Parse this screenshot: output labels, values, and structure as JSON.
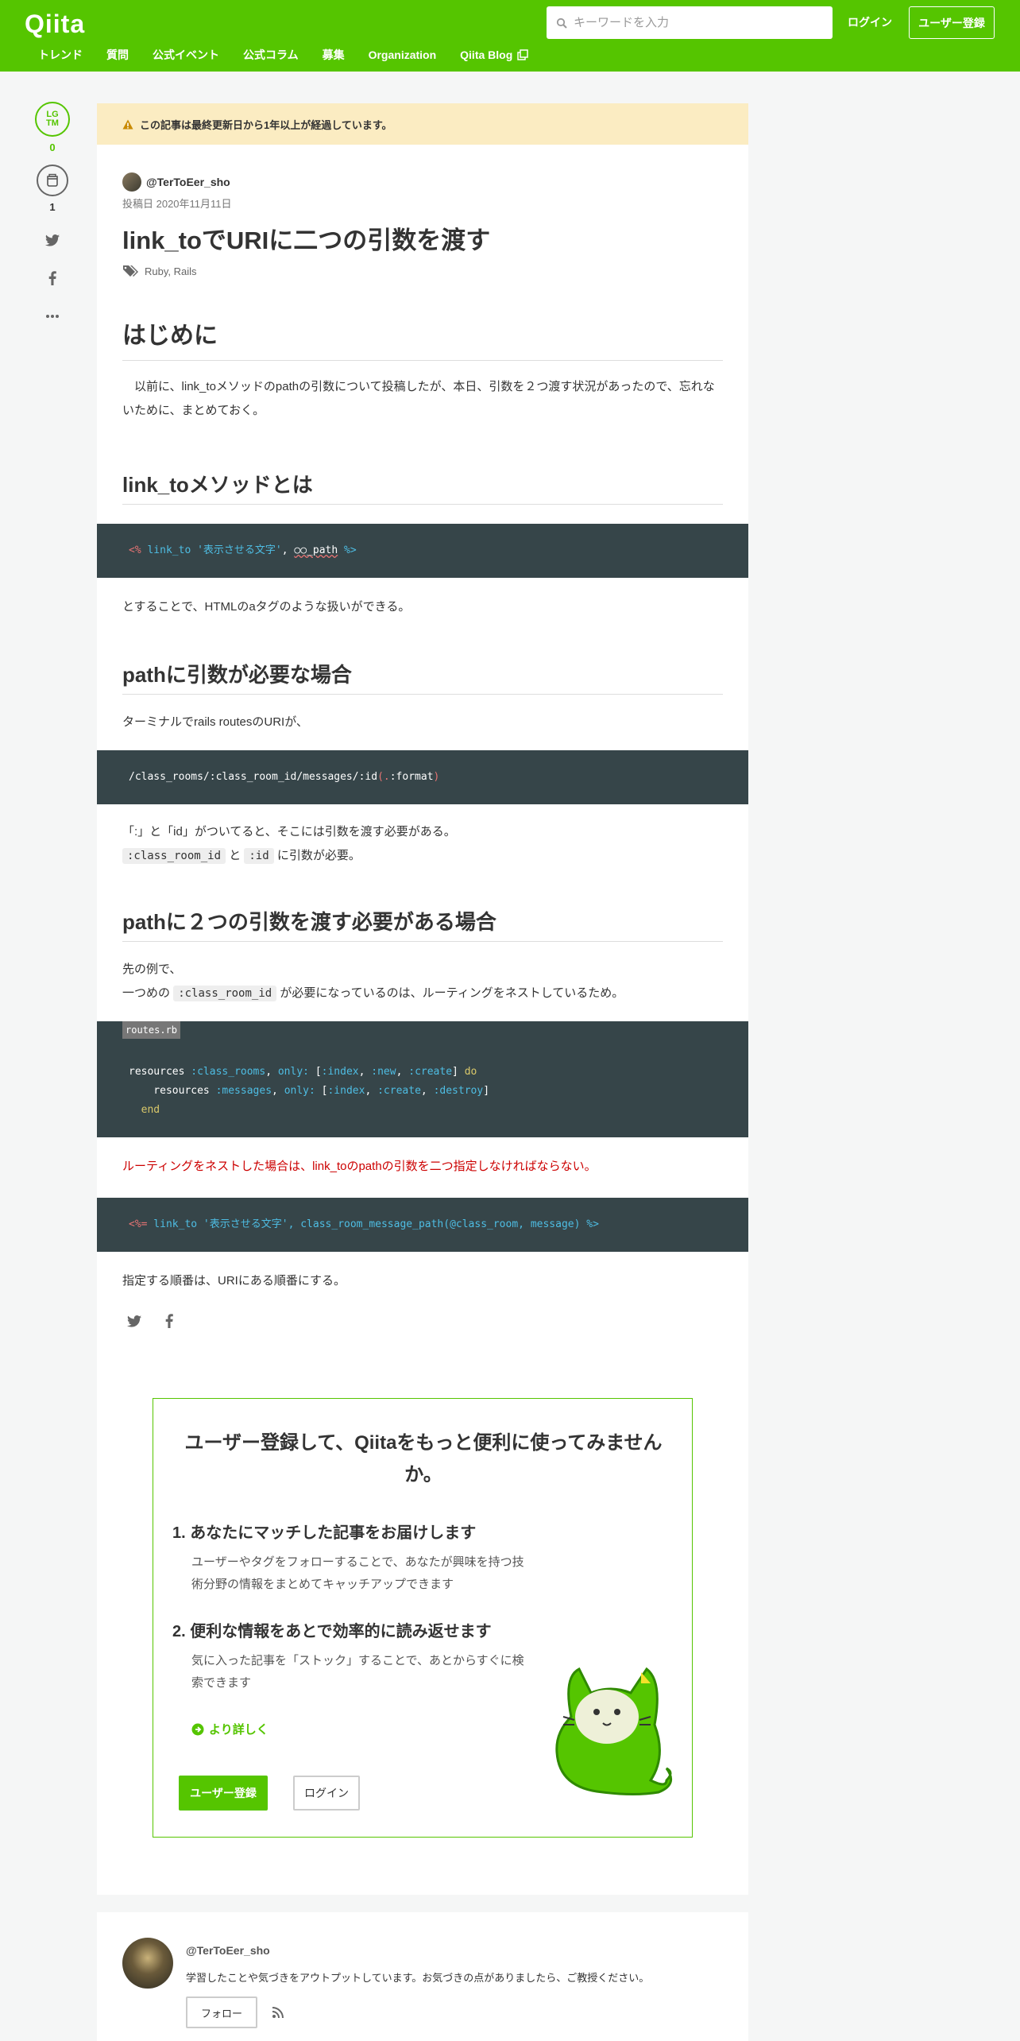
{
  "header": {
    "logo": "Qiita",
    "search_placeholder": "キーワードを入力",
    "login": "ログイン",
    "register": "ユーザー登録",
    "nav": [
      "トレンド",
      "質問",
      "公式イベント",
      "公式コラム",
      "募集",
      "Organization",
      "Qiita Blog"
    ]
  },
  "sidebar": {
    "lgtm_label": "LGTM",
    "lgtm_count": "0",
    "stock_count": "1",
    "icons": [
      "twitter-icon",
      "facebook-icon",
      "more-icon"
    ]
  },
  "article": {
    "notice": "この記事は最終更新日から1年以上が経過しています。",
    "author": "@TerToEer_sho",
    "posted": "投稿日 2020年11月11日",
    "title": "link_toでURIに二つの引数を渡す",
    "tags": "Ruby, Rails",
    "h_intro": "はじめに",
    "p_intro": "以前に、link_toメソッドのpathの引数について投稿したが、本日、引数を２つ渡す状況があったので、忘れないために、まとめておく。",
    "h_linkto": "link_toメソッドとは",
    "code1": {
      "open": "<%",
      "call": " link_to '表示させる文字'",
      "comma": ", ",
      "path": "○○_path",
      "close": " %>"
    },
    "p_linkto": "とすることで、HTMLのaタグのような扱いができる。",
    "h_path_arg": "pathに引数が必要な場合",
    "p_terminal": "ターミナルでrails routesのURIが、",
    "code2": {
      "path": "/class_rooms/:class_room_id/messages/:id",
      "paren_open": "(",
      "dot": ".",
      "format": ":format",
      "paren_close": ")"
    },
    "p_colon": "「:」と「id」がついてると、そこには引数を渡す必要がある。",
    "ic_class_room_id": ":class_room_id",
    "t_to": "と",
    "ic_id": ":id",
    "t_need": "に引数が必要。",
    "h_two_args": "pathに２つの引数を渡す必要がある場合",
    "p_example": "先の例で、",
    "t_first": "一つめの",
    "ic_class_room_id2": ":class_room_id",
    "t_nest": "が必要になっているのは、ルーティングをネストしているため。",
    "filename": "routes.rb",
    "code3": [
      {
        "a": "resources ",
        "b": ":class_rooms",
        "c": ", ",
        "d": "only:",
        "e": " [",
        "f": ":index",
        "g": ", ",
        "h": ":new",
        "i": ", ",
        "j": ":create",
        "k": "] ",
        "l": "do"
      },
      {
        "a": "    resources ",
        "b": ":messages",
        "c": ", ",
        "d": "only:",
        "e": " [",
        "f": ":index",
        "g": ", ",
        "h": ":create",
        "i": ", ",
        "j": ":destroy",
        "k": "]",
        "l": ""
      },
      {
        "end": "end"
      }
    ],
    "p_red": "ルーティングをネストした場合は、link_toのpathの引数を二つ指定しなければならない。",
    "code4": {
      "open": "<%=",
      "rest": " link_to '表示させる文字', class_room_message_path(@class_room, message) %>"
    },
    "p_order": "指定する順番は、URIにある順番にする。"
  },
  "signup": {
    "title": "ユーザー登録して、Qiitaをもっと便利に使ってみませんか。",
    "point1_title": "1. あなたにマッチした記事をお届けします",
    "point1_text": "ユーザーやタグをフォローすることで、あなたが興味を持つ技術分野の情報をまとめてキャッチアップできます",
    "point2_title": "2. 便利な情報をあとで効率的に読み返せます",
    "point2_text": "気に入った記事を「ストック」することで、あとからすぐに検索できます",
    "more": "より詳しく",
    "register": "ユーザー登録",
    "login": "ログイン"
  },
  "author_card": {
    "name": "@TerToEer_sho",
    "bio": "学習したことや気づきをアウトプットしています。お気づきの点がありましたら、ご教授ください。",
    "follow": "フォロー"
  },
  "colors": {
    "brand": "#55c500",
    "code_bg": "#364549",
    "notice_bg": "#fbecc2"
  }
}
